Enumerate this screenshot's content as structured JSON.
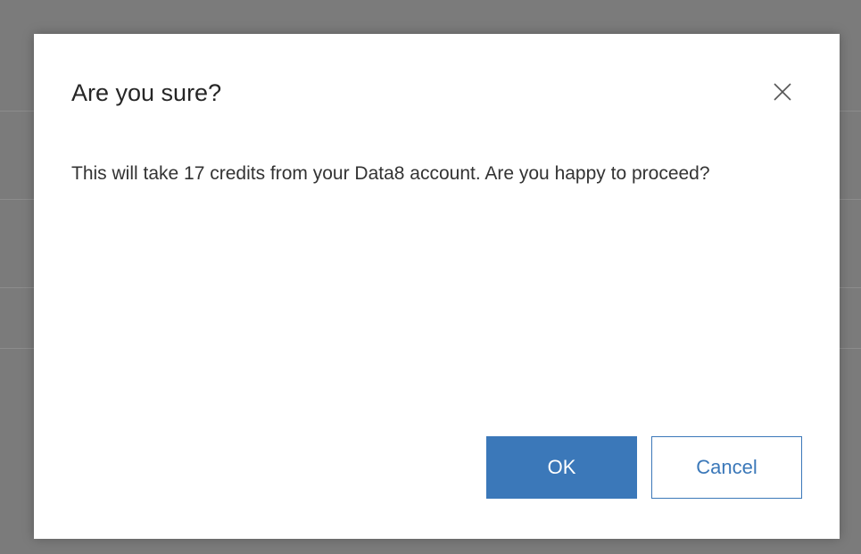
{
  "dialog": {
    "title": "Are you sure?",
    "message": "This will take 17 credits from your Data8 account. Are you happy to proceed?",
    "ok_label": "OK",
    "cancel_label": "Cancel",
    "close_icon": "close-icon"
  },
  "colors": {
    "overlay": "#7b7b7b",
    "primary": "#3b78b9",
    "text": "#262626"
  }
}
